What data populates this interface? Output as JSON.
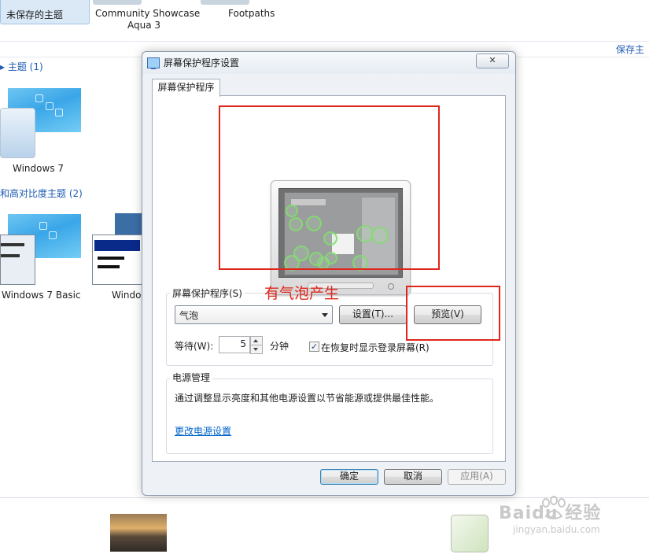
{
  "background": {
    "top_items": [
      "未保存的主题",
      "Community Showcase",
      "Aqua 3",
      "Footpaths"
    ],
    "save_theme_link": "保存主",
    "section_my_themes": "主题 (1)",
    "theme_windows7": "Windows 7",
    "section_basic_high_contrast": "和高对比度主题 (2)",
    "theme_windows7_basic": "Windows 7 Basic",
    "theme_window_partial": "Window"
  },
  "dialog": {
    "title": "屏幕保护程序设置",
    "close_label": "✕",
    "tab_label": "屏幕保护程序",
    "screensaver_group_title": "屏幕保护程序(S)",
    "screensaver_selected": "气泡",
    "settings_button": "设置(T)...",
    "preview_button": "预览(V)",
    "wait_label": "等待(W):",
    "wait_value": "5",
    "minutes_label": "分钟",
    "resume_checkbox_checked": true,
    "resume_label": "在恢复时显示登录屏幕(R)",
    "power_group_title": "电源管理",
    "power_description": "通过调整显示亮度和其他电源设置以节省能源或提供最佳性能。",
    "power_link": "更改电源设置",
    "ok_button": "确定",
    "cancel_button": "取消",
    "apply_button": "应用(A)"
  },
  "annotation": {
    "text": "有气泡产生",
    "color": "#e0261b"
  },
  "watermark": {
    "brand": "Baidu 经验",
    "url": "jingyan.baidu.com"
  }
}
